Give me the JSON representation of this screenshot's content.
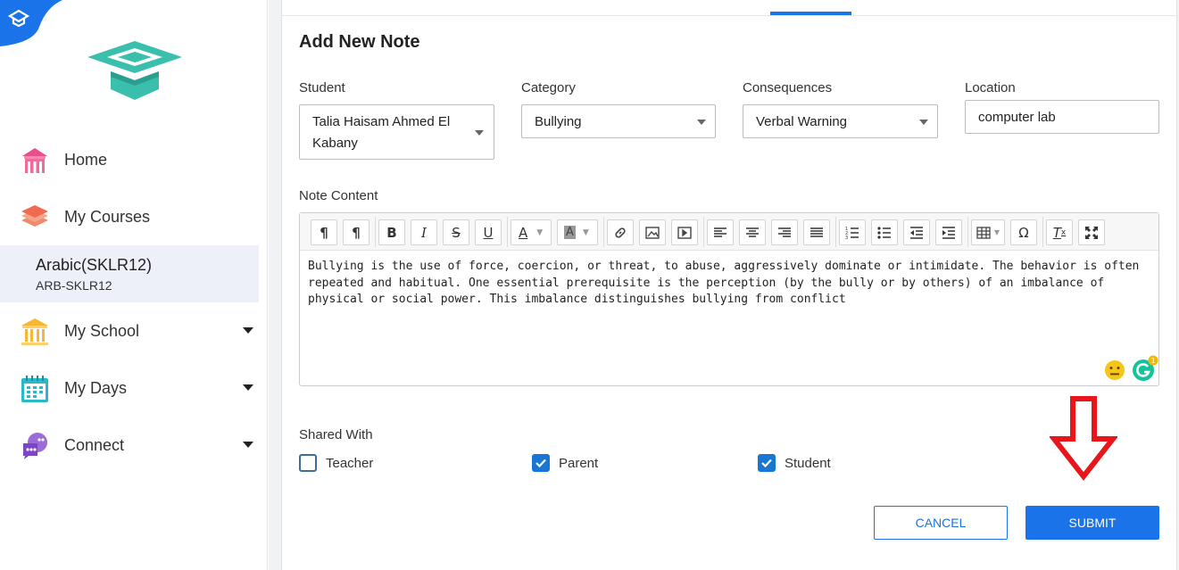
{
  "sidebar": {
    "nav": [
      {
        "label": "Home",
        "icon": "home-icon"
      },
      {
        "label": "My Courses",
        "icon": "courses-icon"
      },
      {
        "label": "My School",
        "icon": "school-icon"
      },
      {
        "label": "My Days",
        "icon": "calendar-icon"
      },
      {
        "label": "Connect",
        "icon": "chat-icon"
      }
    ],
    "course": {
      "name": "Arabic(SKLR12)",
      "code": "ARB-SKLR12"
    }
  },
  "form": {
    "title": "Add New Note",
    "student": {
      "label": "Student",
      "value": "Talia Haisam Ahmed El Kabany"
    },
    "category": {
      "label": "Category",
      "value": "Bullying"
    },
    "consequences": {
      "label": "Consequences",
      "value": "Verbal Warning"
    },
    "location": {
      "label": "Location",
      "value": "computer lab"
    },
    "note_content": {
      "label": "Note Content",
      "text": "Bullying is the use of force, coercion, or threat, to abuse, aggressively dominate or intimidate. The behavior is often repeated and habitual. One essential prerequisite is the perception (by the bully or by others) of an imbalance of physical or social power. This imbalance distinguishes bullying from conflict"
    },
    "shared_with": {
      "label": "Shared With",
      "options": [
        {
          "label": "Teacher",
          "checked": false
        },
        {
          "label": "Parent",
          "checked": true
        },
        {
          "label": "Student",
          "checked": true
        }
      ]
    },
    "buttons": {
      "cancel": "CANCEL",
      "submit": "SUBMIT"
    },
    "grammarly_count": "1"
  },
  "colors": {
    "accent": "#1a73e8",
    "arrow": "#e8161b",
    "logo": "#3bbfad"
  }
}
